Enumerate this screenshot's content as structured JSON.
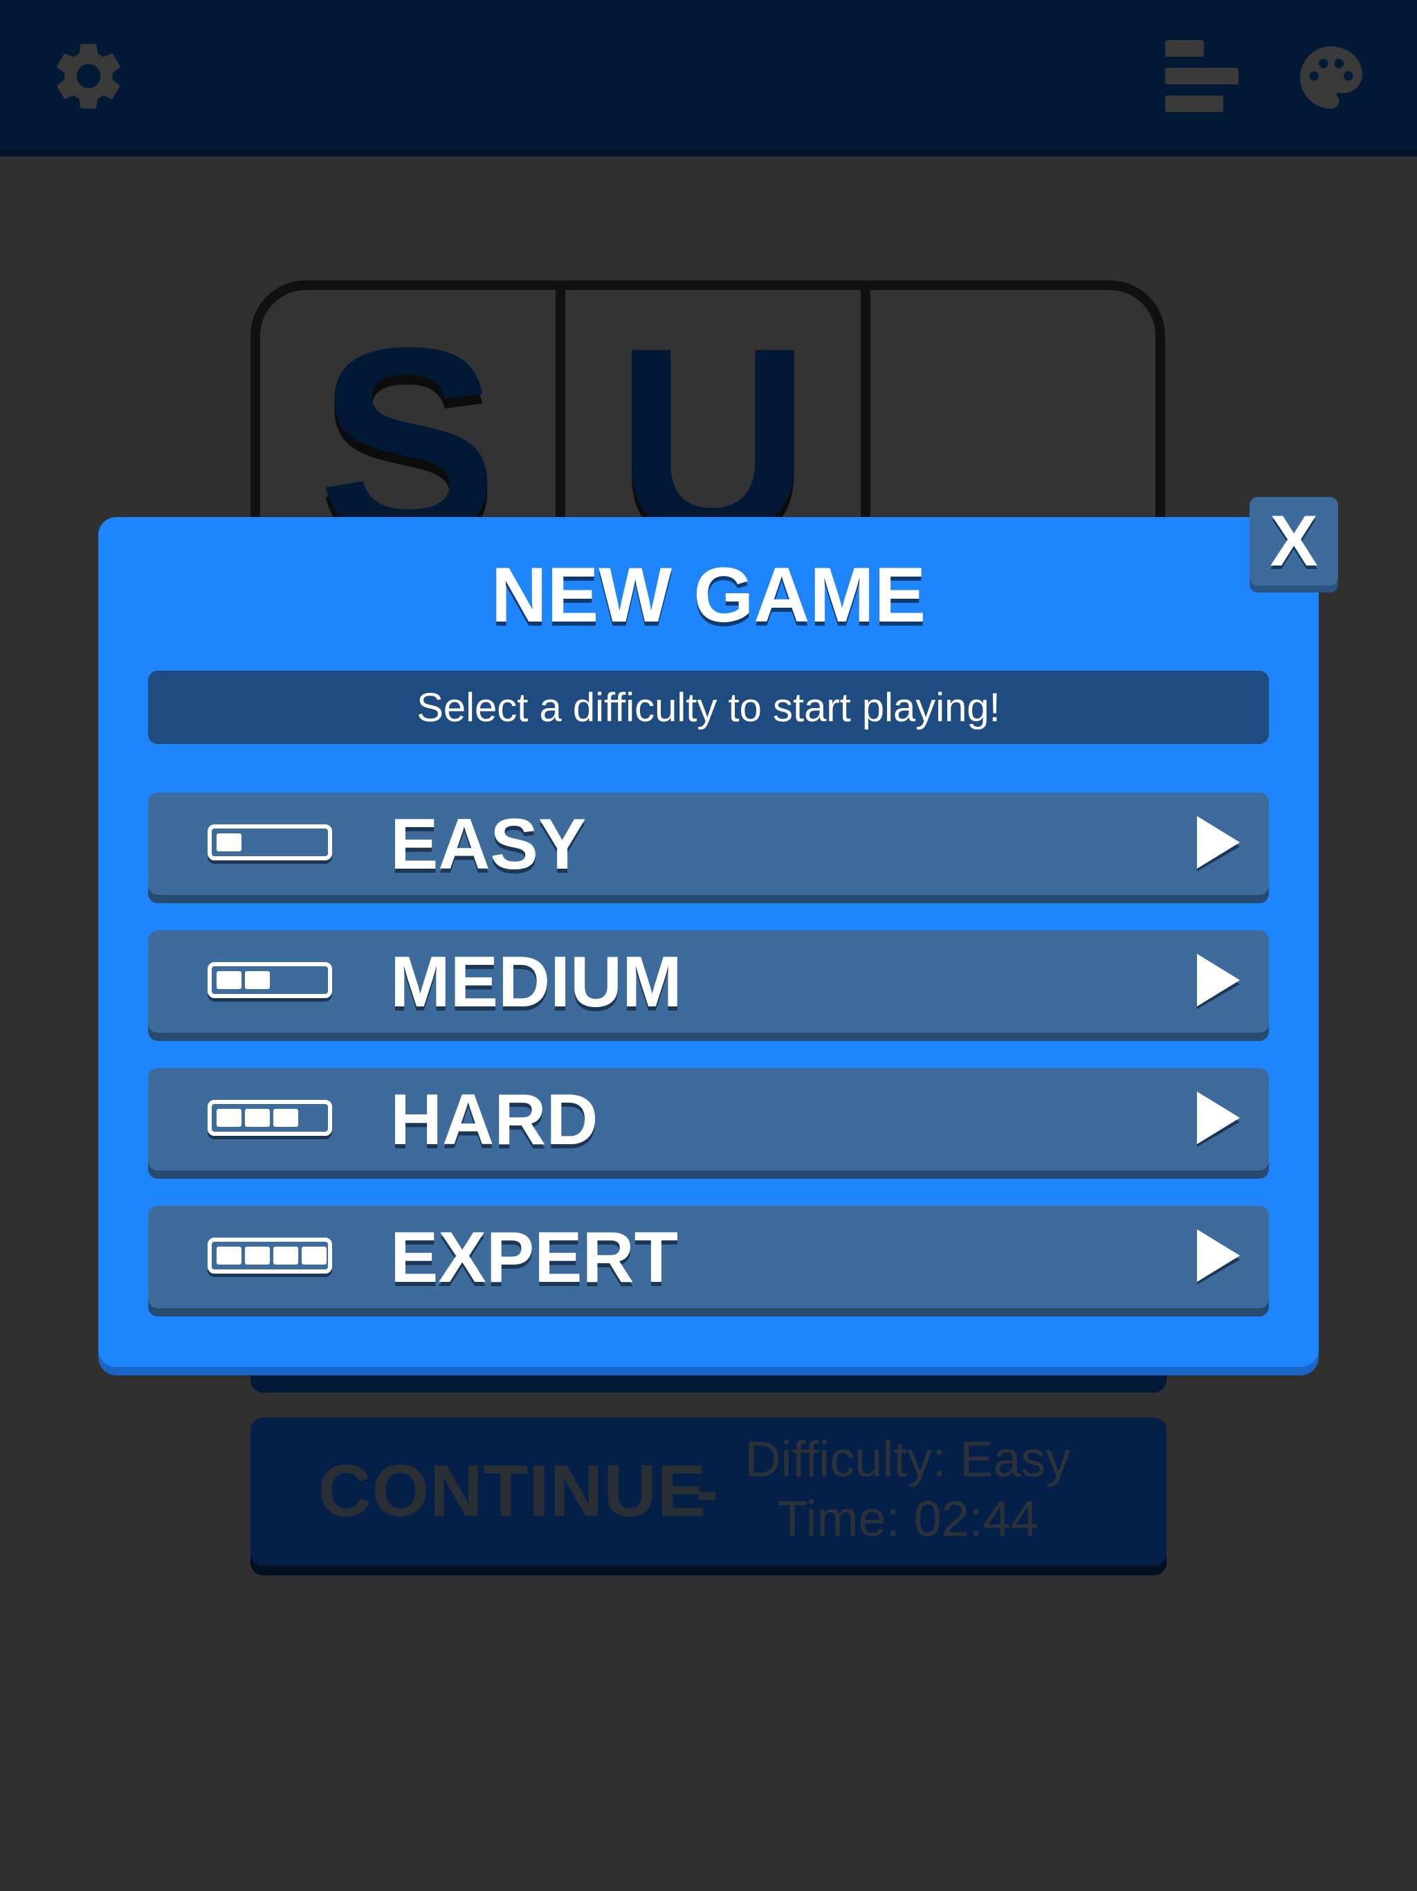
{
  "topbar": {
    "settings_icon": "gear-icon",
    "stats_icon": "leaderboard-icon",
    "theme_icon": "palette-icon",
    "background": "#031a36"
  },
  "logo": {
    "letters": [
      "S",
      "U",
      ""
    ]
  },
  "continue": {
    "label": "CONTINUE",
    "dash": "-",
    "difficulty": "Difficulty: Easy",
    "time": "Time: 02:44"
  },
  "modal": {
    "close_label": "X",
    "title": "NEW GAME",
    "subtitle": "Select a difficulty to start playing!",
    "accent": "#1e85fc",
    "button_color": "#3d6b9b",
    "difficulties": [
      {
        "label": "EASY",
        "level": 1,
        "max_level": 4
      },
      {
        "label": "MEDIUM",
        "level": 2,
        "max_level": 4
      },
      {
        "label": "HARD",
        "level": 3,
        "max_level": 4
      },
      {
        "label": "EXPERT",
        "level": 4,
        "max_level": 4
      }
    ]
  }
}
